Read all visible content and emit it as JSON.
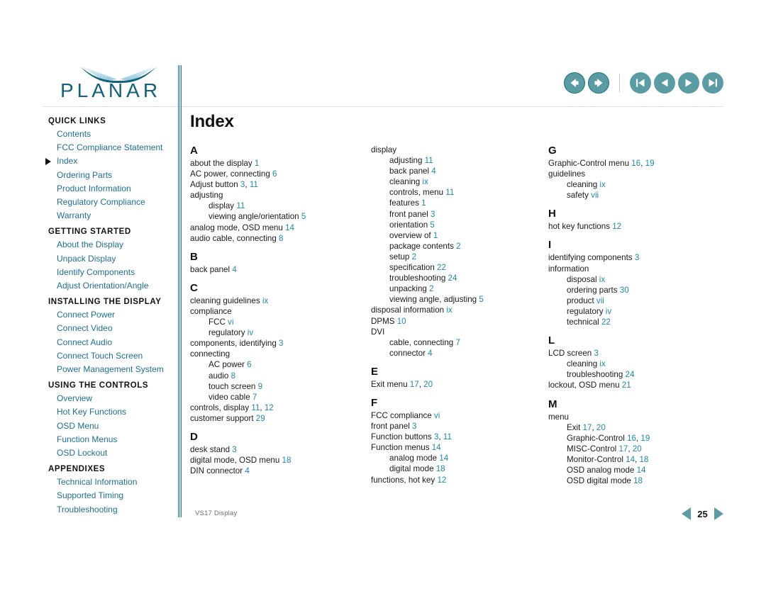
{
  "document": {
    "title": "Index",
    "footer_label": "VS17 Display",
    "page_number": "25"
  },
  "brand": {
    "name": "PLANAR",
    "logo_color": "#136079"
  },
  "toolbar": {
    "buttons": [
      {
        "name": "back-button",
        "icon": "arrow-left-icon"
      },
      {
        "name": "forward-button",
        "icon": "arrow-right-icon"
      },
      {
        "name": "first-page-button",
        "icon": "skip-to-start-icon"
      },
      {
        "name": "previous-page-button",
        "icon": "triangle-left-icon"
      },
      {
        "name": "next-page-button",
        "icon": "triangle-right-icon"
      },
      {
        "name": "last-page-button",
        "icon": "skip-to-end-icon"
      }
    ],
    "button_fill": "#5b9ca4",
    "button_stroke": "#15707f"
  },
  "pager": {
    "prev_icon": "triangle-left-icon",
    "next_icon": "triangle-right-icon",
    "number": "25"
  },
  "sidebar": {
    "link_color": "#1d6f94",
    "active_item": "Index",
    "groups": [
      {
        "heading": "QUICK LINKS",
        "items": [
          {
            "label": "Contents",
            "active": false
          },
          {
            "label": "FCC Compliance Statement",
            "active": false
          },
          {
            "label": "Index",
            "active": true
          },
          {
            "label": "Ordering Parts",
            "active": false
          },
          {
            "label": "Product Information",
            "active": false
          },
          {
            "label": "Regulatory Compliance",
            "active": false
          },
          {
            "label": "Warranty",
            "active": false
          }
        ]
      },
      {
        "heading": "GETTING STARTED",
        "items": [
          {
            "label": "About the Display",
            "active": false
          },
          {
            "label": "Unpack Display",
            "active": false
          },
          {
            "label": "Identify Components",
            "active": false
          },
          {
            "label": "Adjust Orientation/Angle",
            "active": false
          }
        ]
      },
      {
        "heading": "INSTALLING THE DISPLAY",
        "items": [
          {
            "label": "Connect Power",
            "active": false
          },
          {
            "label": "Connect Video",
            "active": false
          },
          {
            "label": "Connect Audio",
            "active": false
          },
          {
            "label": "Connect Touch Screen",
            "active": false
          },
          {
            "label": "Power Management System",
            "active": false
          }
        ]
      },
      {
        "heading": "USING THE CONTROLS",
        "items": [
          {
            "label": "Overview",
            "active": false
          },
          {
            "label": "Hot Key Functions",
            "active": false
          },
          {
            "label": "OSD Menu",
            "active": false
          },
          {
            "label": "Function Menus",
            "active": false
          },
          {
            "label": "OSD Lockout",
            "active": false
          }
        ]
      },
      {
        "heading": "APPENDIXES",
        "items": [
          {
            "label": "Technical Information",
            "active": false
          },
          {
            "label": "Supported Timing",
            "active": false
          },
          {
            "label": "Troubleshooting",
            "active": false
          }
        ]
      }
    ]
  },
  "index": {
    "page_color": "#2188a8",
    "columns": [
      {
        "sections": [
          {
            "letter": "A",
            "entries": [
              {
                "text": "about the display",
                "pages": [
                  "1"
                ],
                "sub": false
              },
              {
                "text": "AC power, connecting",
                "pages": [
                  "6"
                ],
                "sub": false
              },
              {
                "text": "Adjust button",
                "pages": [
                  "3",
                  "11"
                ],
                "sub": false
              },
              {
                "text": "adjusting",
                "pages": [],
                "sub": false
              },
              {
                "text": "display",
                "pages": [
                  "11"
                ],
                "sub": true
              },
              {
                "text": "viewing angle/orientation",
                "pages": [
                  "5"
                ],
                "sub": true
              },
              {
                "text": "analog mode, OSD menu",
                "pages": [
                  "14"
                ],
                "sub": false
              },
              {
                "text": "audio cable, connecting",
                "pages": [
                  "8"
                ],
                "sub": false
              }
            ]
          },
          {
            "letter": "B",
            "entries": [
              {
                "text": "back panel",
                "pages": [
                  "4"
                ],
                "sub": false
              }
            ]
          },
          {
            "letter": "C",
            "entries": [
              {
                "text": "cleaning guidelines",
                "pages": [
                  "ix"
                ],
                "sub": false
              },
              {
                "text": "compliance",
                "pages": [],
                "sub": false
              },
              {
                "text": "FCC",
                "pages": [
                  "vi"
                ],
                "sub": true
              },
              {
                "text": "regulatory",
                "pages": [
                  "iv"
                ],
                "sub": true
              },
              {
                "text": "components, identifying",
                "pages": [
                  "3"
                ],
                "sub": false
              },
              {
                "text": "connecting",
                "pages": [],
                "sub": false
              },
              {
                "text": "AC power",
                "pages": [
                  "6"
                ],
                "sub": true
              },
              {
                "text": "audio",
                "pages": [
                  "8"
                ],
                "sub": true
              },
              {
                "text": "touch screen",
                "pages": [
                  "9"
                ],
                "sub": true
              },
              {
                "text": "video cable",
                "pages": [
                  "7"
                ],
                "sub": true
              },
              {
                "text": "controls, display",
                "pages": [
                  "11",
                  "12"
                ],
                "sub": false
              },
              {
                "text": "customer support",
                "pages": [
                  "29"
                ],
                "sub": false
              }
            ]
          },
          {
            "letter": "D",
            "entries": [
              {
                "text": "desk stand",
                "pages": [
                  "3"
                ],
                "sub": false
              },
              {
                "text": "digital mode, OSD menu",
                "pages": [
                  "18"
                ],
                "sub": false
              },
              {
                "text": "DIN connector",
                "pages": [
                  "4"
                ],
                "sub": false
              }
            ]
          }
        ]
      },
      {
        "sections": [
          {
            "letter": "",
            "entries": [
              {
                "text": "display",
                "pages": [],
                "sub": false
              },
              {
                "text": "adjusting",
                "pages": [
                  "11"
                ],
                "sub": true
              },
              {
                "text": "back panel",
                "pages": [
                  "4"
                ],
                "sub": true
              },
              {
                "text": "cleaning",
                "pages": [
                  "ix"
                ],
                "sub": true
              },
              {
                "text": "controls, menu",
                "pages": [
                  "11"
                ],
                "sub": true
              },
              {
                "text": "features",
                "pages": [
                  "1"
                ],
                "sub": true
              },
              {
                "text": "front panel",
                "pages": [
                  "3"
                ],
                "sub": true
              },
              {
                "text": "orientation",
                "pages": [
                  "5"
                ],
                "sub": true
              },
              {
                "text": "overview of",
                "pages": [
                  "1"
                ],
                "sub": true
              },
              {
                "text": "package contents",
                "pages": [
                  "2"
                ],
                "sub": true
              },
              {
                "text": "setup",
                "pages": [
                  "2"
                ],
                "sub": true
              },
              {
                "text": "specification",
                "pages": [
                  "22"
                ],
                "sub": true
              },
              {
                "text": "troubleshooting",
                "pages": [
                  "24"
                ],
                "sub": true
              },
              {
                "text": "unpacking",
                "pages": [
                  "2"
                ],
                "sub": true
              },
              {
                "text": "viewing angle, adjusting",
                "pages": [
                  "5"
                ],
                "sub": true
              },
              {
                "text": "disposal information",
                "pages": [
                  "ix"
                ],
                "sub": false
              },
              {
                "text": "DPMS",
                "pages": [
                  "10"
                ],
                "sub": false
              },
              {
                "text": "DVI",
                "pages": [],
                "sub": false
              },
              {
                "text": "cable, connecting",
                "pages": [
                  "7"
                ],
                "sub": true
              },
              {
                "text": "connector",
                "pages": [
                  "4"
                ],
                "sub": true
              }
            ]
          },
          {
            "letter": "E",
            "entries": [
              {
                "text": "Exit menu",
                "pages": [
                  "17",
                  "20"
                ],
                "sub": false
              }
            ]
          },
          {
            "letter": "F",
            "entries": [
              {
                "text": "FCC compliance",
                "pages": [
                  "vi"
                ],
                "sub": false
              },
              {
                "text": "front panel",
                "pages": [
                  "3"
                ],
                "sub": false
              },
              {
                "text": "Function buttons",
                "pages": [
                  "3",
                  "11"
                ],
                "sub": false
              },
              {
                "text": "Function menus",
                "pages": [
                  "14"
                ],
                "sub": false
              },
              {
                "text": "analog mode",
                "pages": [
                  "14"
                ],
                "sub": true
              },
              {
                "text": "digital mode",
                "pages": [
                  "18"
                ],
                "sub": true
              },
              {
                "text": "functions, hot key",
                "pages": [
                  "12"
                ],
                "sub": false
              }
            ]
          }
        ]
      },
      {
        "sections": [
          {
            "letter": "G",
            "entries": [
              {
                "text": "Graphic-Control menu",
                "pages": [
                  "16",
                  "19"
                ],
                "sub": false
              },
              {
                "text": "guidelines",
                "pages": [],
                "sub": false
              },
              {
                "text": "cleaning",
                "pages": [
                  "ix"
                ],
                "sub": true
              },
              {
                "text": "safety",
                "pages": [
                  "vii"
                ],
                "sub": true
              }
            ]
          },
          {
            "letter": "H",
            "entries": [
              {
                "text": "hot key functions",
                "pages": [
                  "12"
                ],
                "sub": false
              }
            ]
          },
          {
            "letter": "I",
            "entries": [
              {
                "text": "identifying components",
                "pages": [
                  "3"
                ],
                "sub": false
              },
              {
                "text": "information",
                "pages": [],
                "sub": false
              },
              {
                "text": "disposal",
                "pages": [
                  "ix"
                ],
                "sub": true
              },
              {
                "text": "ordering parts",
                "pages": [
                  "30"
                ],
                "sub": true
              },
              {
                "text": "product",
                "pages": [
                  "vii"
                ],
                "sub": true
              },
              {
                "text": "regulatory",
                "pages": [
                  "iv"
                ],
                "sub": true
              },
              {
                "text": "technical",
                "pages": [
                  "22"
                ],
                "sub": true
              }
            ]
          },
          {
            "letter": "L",
            "entries": [
              {
                "text": "LCD screen",
                "pages": [
                  "3"
                ],
                "sub": false
              },
              {
                "text": "cleaning",
                "pages": [
                  "ix"
                ],
                "sub": true
              },
              {
                "text": "troubleshooting",
                "pages": [
                  "24"
                ],
                "sub": true
              },
              {
                "text": "lockout, OSD menu",
                "pages": [
                  "21"
                ],
                "sub": false
              }
            ]
          },
          {
            "letter": "M",
            "entries": [
              {
                "text": "menu",
                "pages": [],
                "sub": false
              },
              {
                "text": "Exit",
                "pages": [
                  "17",
                  "20"
                ],
                "sub": true
              },
              {
                "text": "Graphic-Control",
                "pages": [
                  "16",
                  "19"
                ],
                "sub": true
              },
              {
                "text": "MISC-Control",
                "pages": [
                  "17",
                  "20"
                ],
                "sub": true
              },
              {
                "text": "Monitor-Control",
                "pages": [
                  "14",
                  "18"
                ],
                "sub": true
              },
              {
                "text": "OSD analog mode",
                "pages": [
                  "14"
                ],
                "sub": true
              },
              {
                "text": "OSD digital mode",
                "pages": [
                  "18"
                ],
                "sub": true
              }
            ]
          }
        ]
      }
    ]
  }
}
